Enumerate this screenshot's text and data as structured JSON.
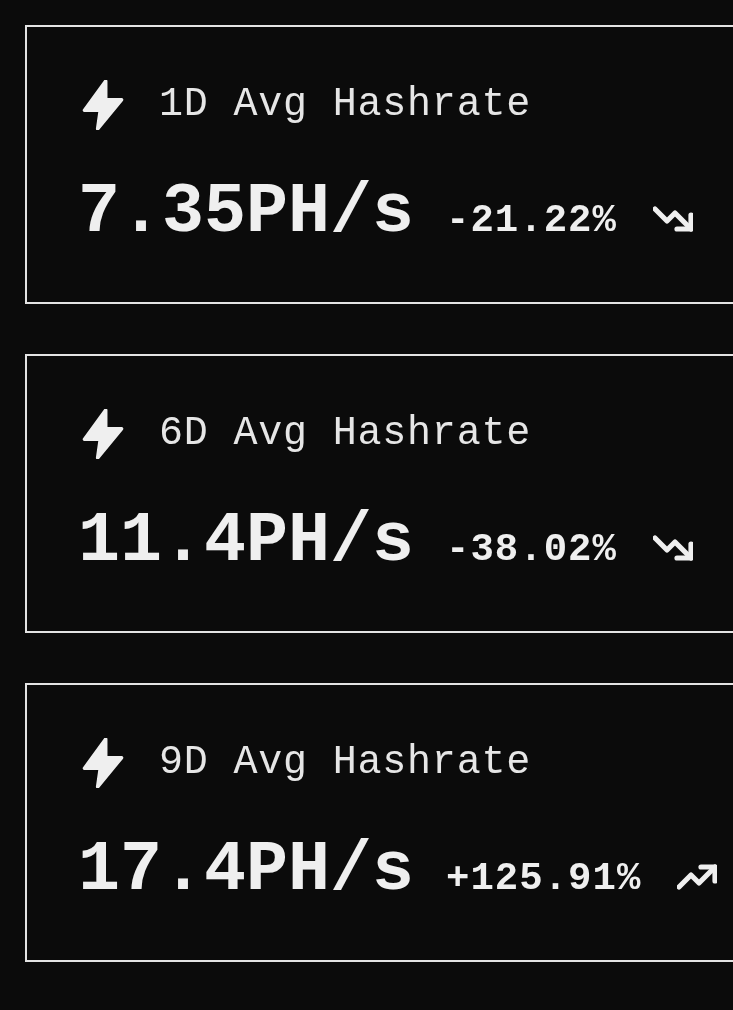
{
  "cards": [
    {
      "title": "1D Avg Hashrate",
      "value": "7.35PH/s",
      "change": "-21.22%",
      "kind": "down"
    },
    {
      "title": "6D Avg Hashrate",
      "value": "11.4PH/s",
      "change": "-38.02%",
      "kind": "down"
    },
    {
      "title": "9D Avg Hashrate",
      "value": "17.4PH/s",
      "change": "+125.91%",
      "kind": "up"
    }
  ]
}
